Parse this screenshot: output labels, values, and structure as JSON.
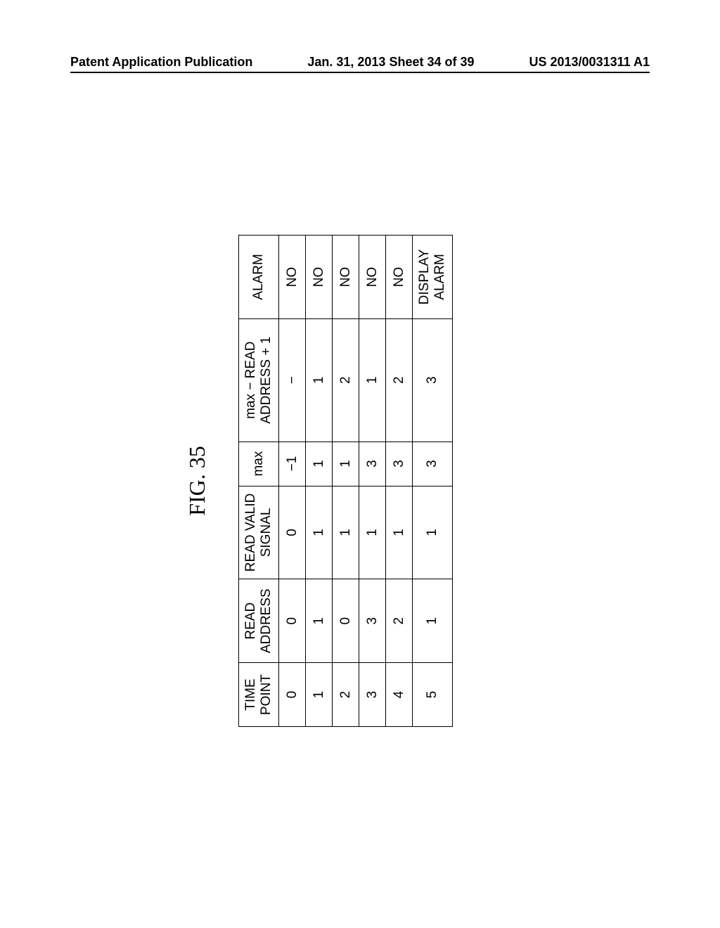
{
  "header": {
    "left": "Patent Application Publication",
    "center": "Jan. 31, 2013  Sheet 34 of 39",
    "right": "US 2013/0031311 A1"
  },
  "figure_label": "FIG. 35",
  "chart_data": {
    "type": "table",
    "headers": [
      "TIME POINT",
      "READ ADDRESS",
      "READ VALID SIGNAL",
      "max",
      "max − READ ADDRESS + 1",
      "ALARM"
    ],
    "rows": [
      [
        "0",
        "0",
        "0",
        "−1",
        "−",
        "NO"
      ],
      [
        "1",
        "1",
        "1",
        "1",
        "1",
        "NO"
      ],
      [
        "2",
        "0",
        "1",
        "1",
        "2",
        "NO"
      ],
      [
        "3",
        "3",
        "1",
        "3",
        "1",
        "NO"
      ],
      [
        "4",
        "2",
        "1",
        "3",
        "2",
        "NO"
      ],
      [
        "5",
        "1",
        "1",
        "3",
        "3",
        "DISPLAY ALARM"
      ]
    ]
  }
}
